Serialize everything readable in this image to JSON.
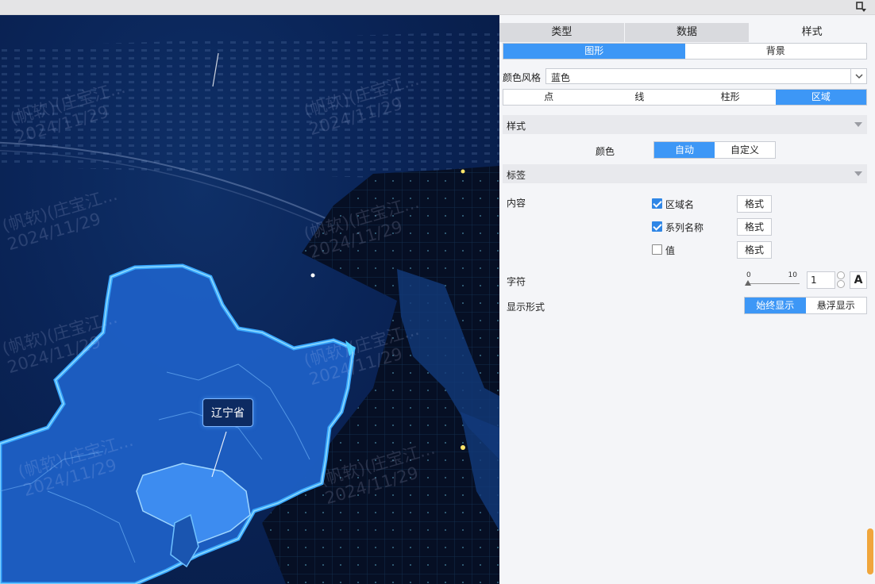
{
  "map": {
    "tooltip_label": "辽宁省",
    "watermarks": [
      "(帆软)(庄宝江...",
      "2024/11/29"
    ]
  },
  "panel": {
    "tabs": [
      "类型",
      "数据",
      "样式"
    ],
    "active_tab": "样式",
    "subtabs": [
      "图形",
      "背景"
    ],
    "active_subtab": "图形",
    "color_style": {
      "label": "颜色风格",
      "value": "蓝色"
    },
    "element_tabs": [
      "点",
      "线",
      "柱形",
      "区域"
    ],
    "active_element_tab": "区域",
    "style_section": {
      "title": "样式",
      "color_label": "颜色",
      "color_options": [
        "自动",
        "自定义"
      ],
      "color_selected": "自动"
    },
    "label_section": {
      "title": "标签",
      "content_label": "内容",
      "items": [
        {
          "label": "区域名",
          "checked": true,
          "button": "格式"
        },
        {
          "label": "系列名称",
          "checked": true,
          "button": "格式"
        },
        {
          "label": "值",
          "checked": false,
          "button": "格式"
        }
      ],
      "char_label": "字符",
      "slider_min": "0",
      "slider_max": "10",
      "char_value": "1",
      "font_button": "A",
      "display_label": "显示形式",
      "display_options": [
        "始终显示",
        "悬浮显示"
      ],
      "display_selected": "始终显示"
    }
  },
  "colors": {
    "accent": "#3d97f6",
    "map_bg": "#0a2457",
    "region": "#1e64c8",
    "highlight": "#3d8cf0",
    "scroll": "#f0a63c"
  }
}
